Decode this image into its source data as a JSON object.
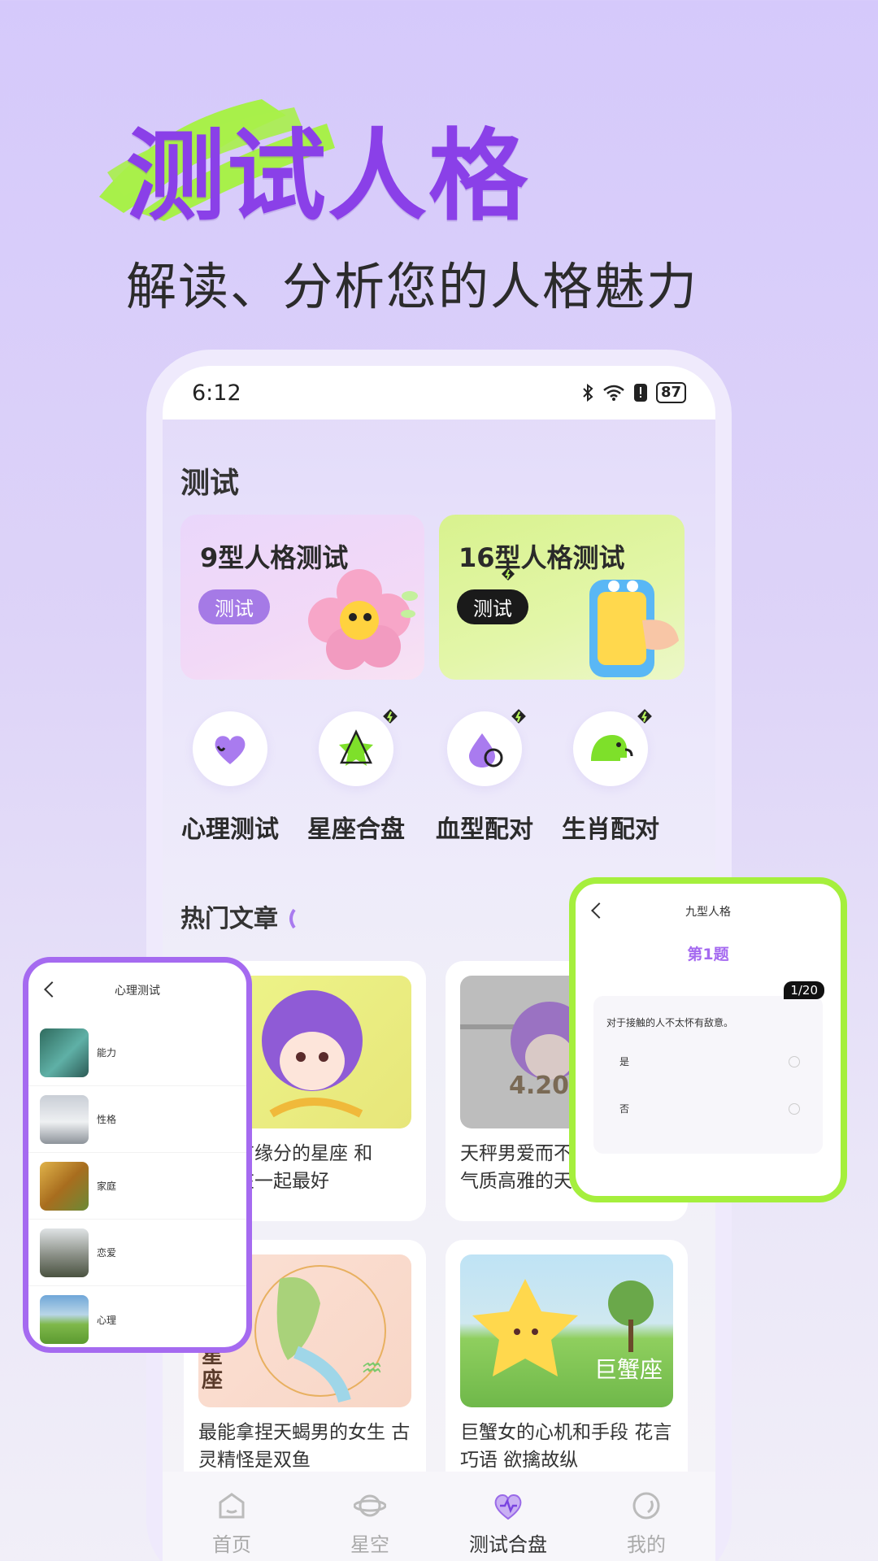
{
  "hero": {
    "title": "测试人格",
    "subtitle": "解读、分析您的人格魅力"
  },
  "status_bar": {
    "time": "6:12",
    "battery": "87"
  },
  "tests_section": {
    "title": "测试",
    "cards": [
      {
        "title": "9型人格测试",
        "button": "测试"
      },
      {
        "title": "16型人格测试",
        "button": "测试"
      }
    ]
  },
  "categories": [
    {
      "label": "心理测试",
      "icon": "heart-icon"
    },
    {
      "label": "星座合盘",
      "icon": "star-icon"
    },
    {
      "label": "血型配对",
      "icon": "drop-icon"
    },
    {
      "label": "生肖配对",
      "icon": "elephant-icon"
    }
  ],
  "hot_section": {
    "title": "热门文章"
  },
  "articles": [
    {
      "text": "座最有缘分的星座 和\n星座在一起最好"
    },
    {
      "text": "天秤男爱而不\n气质高雅的天"
    },
    {
      "text": "最能拿捏天蝎男的女生 古\n灵精怪是双鱼"
    },
    {
      "text": "巨蟹女的心机和手段 花言\n巧语 欲擒故纵"
    }
  ],
  "article_img_labels": [
    "4.20",
    "巨蟹座",
    "星座"
  ],
  "bottom_nav": [
    {
      "label": "首页",
      "icon": "home-icon"
    },
    {
      "label": "星空",
      "icon": "planet-icon"
    },
    {
      "label": "测试合盘",
      "icon": "heart-chart-icon",
      "active": true
    },
    {
      "label": "我的",
      "icon": "profile-icon"
    }
  ],
  "panel_left": {
    "title": "心理测试",
    "items": [
      "能力",
      "性格",
      "家庭",
      "恋爱",
      "心理"
    ]
  },
  "panel_right": {
    "title": "九型人格",
    "question_title": "第1题",
    "progress": "1/20",
    "question": "对于接触的人不太怀有敌意。",
    "options": [
      "是",
      "否"
    ]
  },
  "colors": {
    "accent_purple": "#8a40e8",
    "accent_green": "#a5ef3d",
    "panel_purple": "#a56af0"
  }
}
